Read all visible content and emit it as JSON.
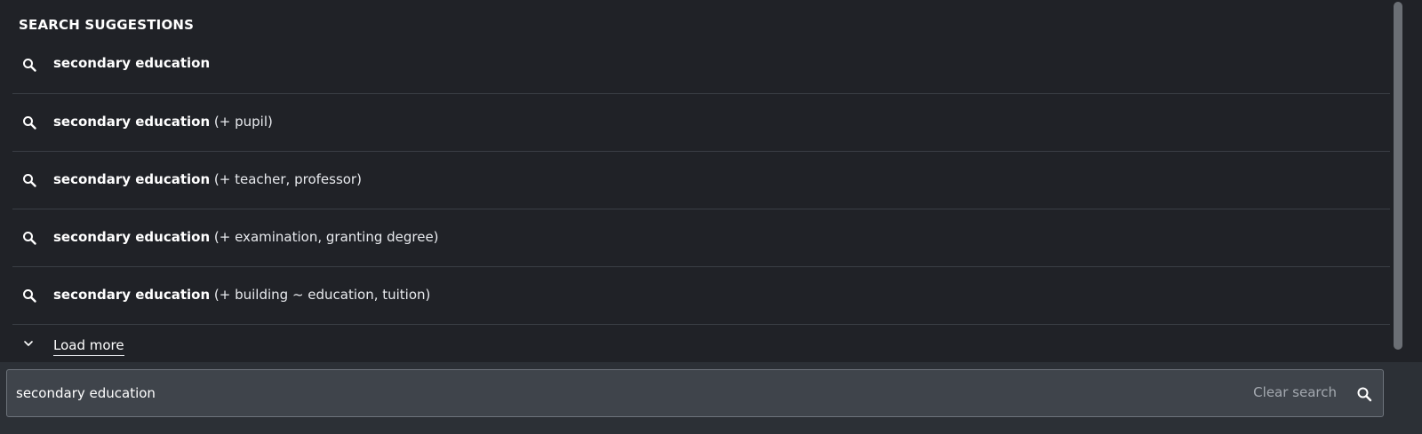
{
  "suggestions_panel": {
    "heading": "SEARCH SUGGESTIONS",
    "items": [
      {
        "term": "secondary education",
        "extra": ""
      },
      {
        "term": "secondary education",
        "extra": " (+ pupil)"
      },
      {
        "term": "secondary education",
        "extra": " (+ teacher, professor)"
      },
      {
        "term": "secondary education",
        "extra": " (+ examination, granting degree)"
      },
      {
        "term": "secondary education",
        "extra": " (+ building ~ education, tuition)"
      }
    ],
    "load_more_label": "Load more"
  },
  "search": {
    "value": "secondary education",
    "clear_label": "Clear search"
  },
  "icons": {
    "suggestion": "search-icon",
    "load_more": "chevron-down-icon",
    "submit": "search-icon"
  },
  "colors": {
    "panel_bg": "#202227",
    "divider": "#3a3e45",
    "field_bg": "#3f444b",
    "text": "#ffffff",
    "muted": "#a4a9b0"
  }
}
